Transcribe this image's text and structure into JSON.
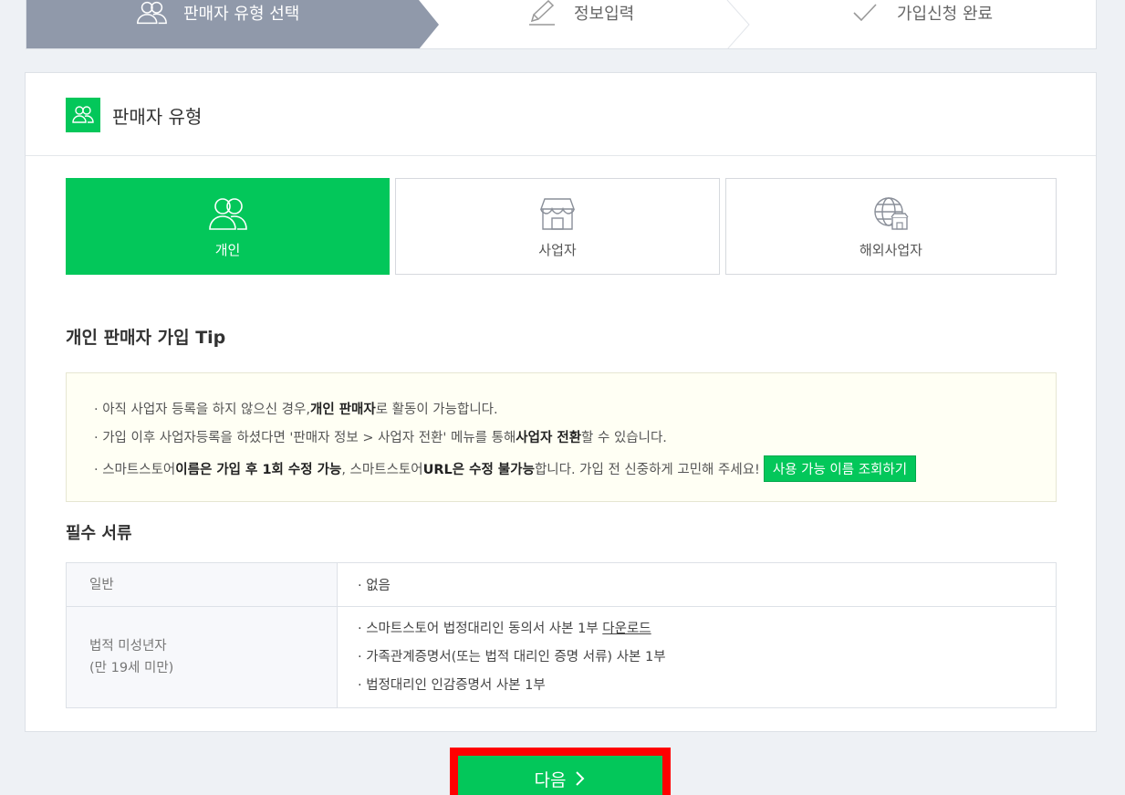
{
  "steps": [
    {
      "label": "판매자 유형 선택",
      "icon": "people-icon"
    },
    {
      "label": "정보입력",
      "icon": "pencil-icon"
    },
    {
      "label": "가입신청 완료",
      "icon": "check-icon"
    }
  ],
  "section": {
    "title": "판매자 유형"
  },
  "types": [
    {
      "label": "개인",
      "icon": "people-icon"
    },
    {
      "label": "사업자",
      "icon": "store-icon"
    },
    {
      "label": "해외사업자",
      "icon": "globe-store-icon"
    }
  ],
  "tip": {
    "title": "개인 판매자 가입 Tip",
    "line1": {
      "a": "· 아직 사업자 등록을 하지 않으신 경우, ",
      "b": "개인 판매자",
      "c": "로 활동이 가능합니다."
    },
    "line2": {
      "a": "· 가입 이후 사업자등록을 하셨다면 '판매자 정보 > 사업자 전환' 메뉴를 통해 ",
      "b": "사업자 전환",
      "c": "할 수 있습니다."
    },
    "line3": {
      "a": "· 스마트스토어 ",
      "b": "이름은 가입 후 1회 수정 가능",
      "c": ", 스마트스토어 ",
      "d": "URL은 수정 불가능",
      "e": "합니다. 가입 전 신중하게 고민해 주세요!"
    },
    "name_check_button": "사용 가능 이름 조회하기"
  },
  "docs": {
    "title": "필수 서류",
    "general_label": "일반",
    "general_value": "· 없음",
    "minor_label_1": "법적 미성년자",
    "minor_label_2": "(만 19세 미만)",
    "minor_item1_text": "· 스마트스토어 법정대리인 동의서 사본 1부 ",
    "minor_item1_link": "다운로드",
    "minor_item2": "· 가족관계증명서(또는 법적 대리인 증명 서류) 사본 1부",
    "minor_item3": "· 법정대리인 인감증명서 사본 1부"
  },
  "next_button": "다음",
  "colors": {
    "brand_green": "#03c75a",
    "step_active": "#9099aa",
    "highlight": "#ff0000"
  }
}
